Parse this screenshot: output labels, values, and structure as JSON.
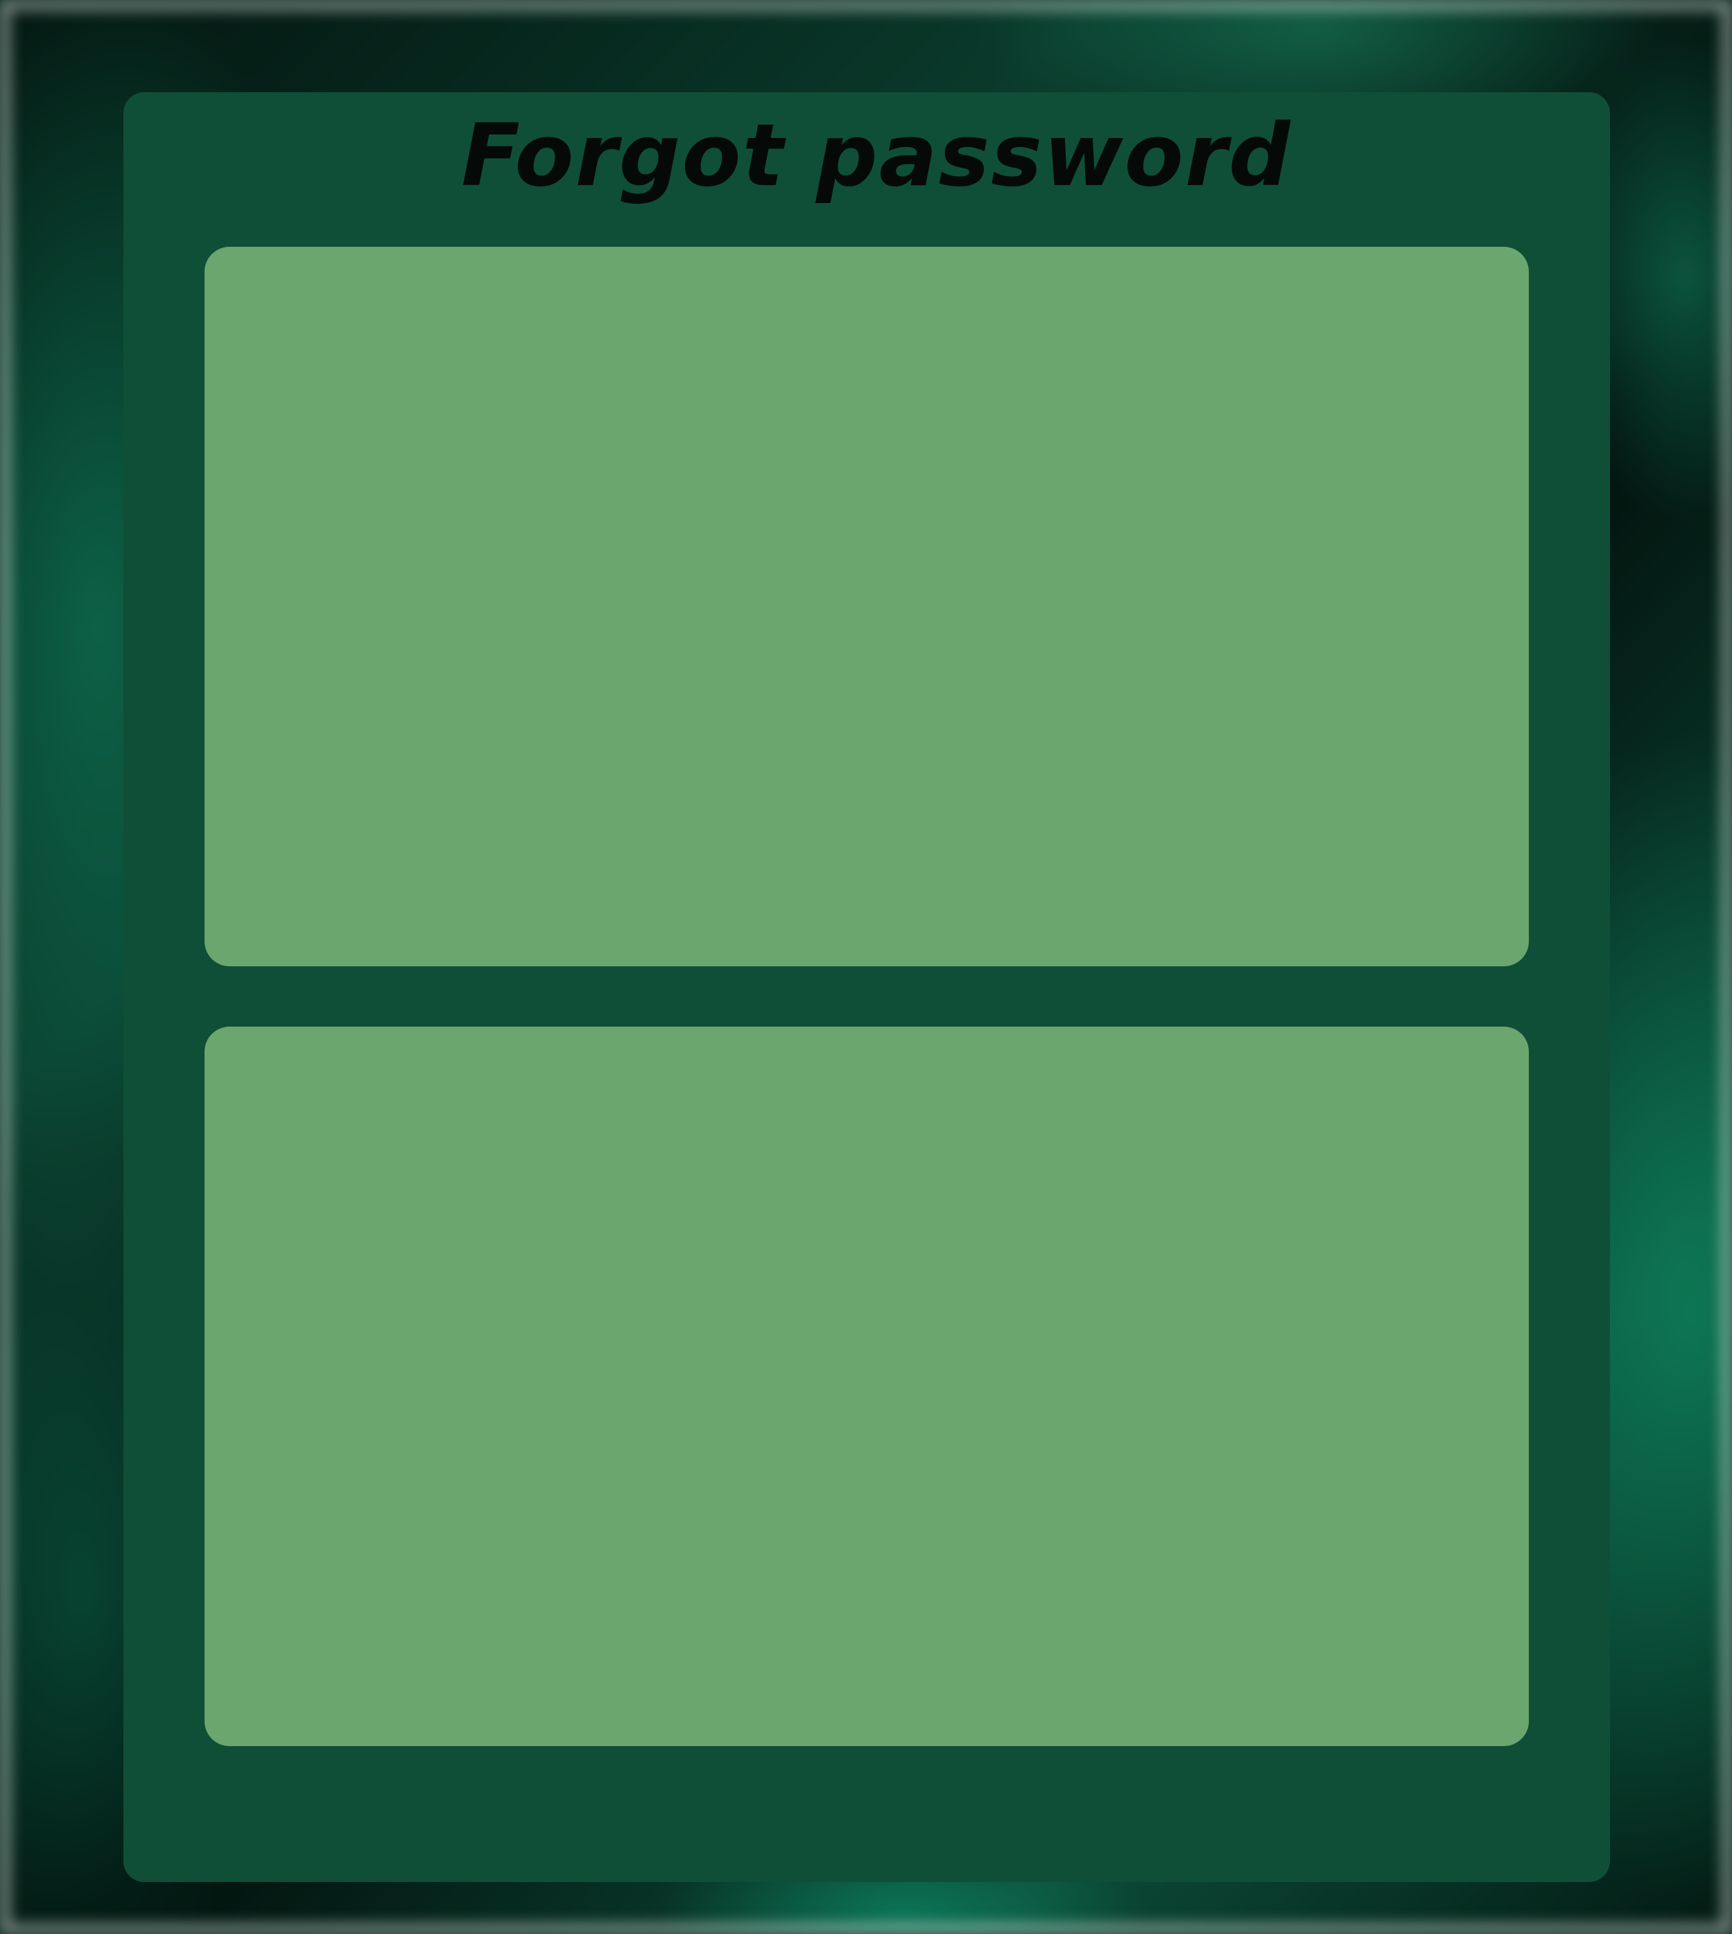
{
  "form": {
    "title": "Forgot password"
  },
  "colors": {
    "panel": "#0f4f38",
    "field": "#6ba66e",
    "title_text": "#050a08"
  }
}
